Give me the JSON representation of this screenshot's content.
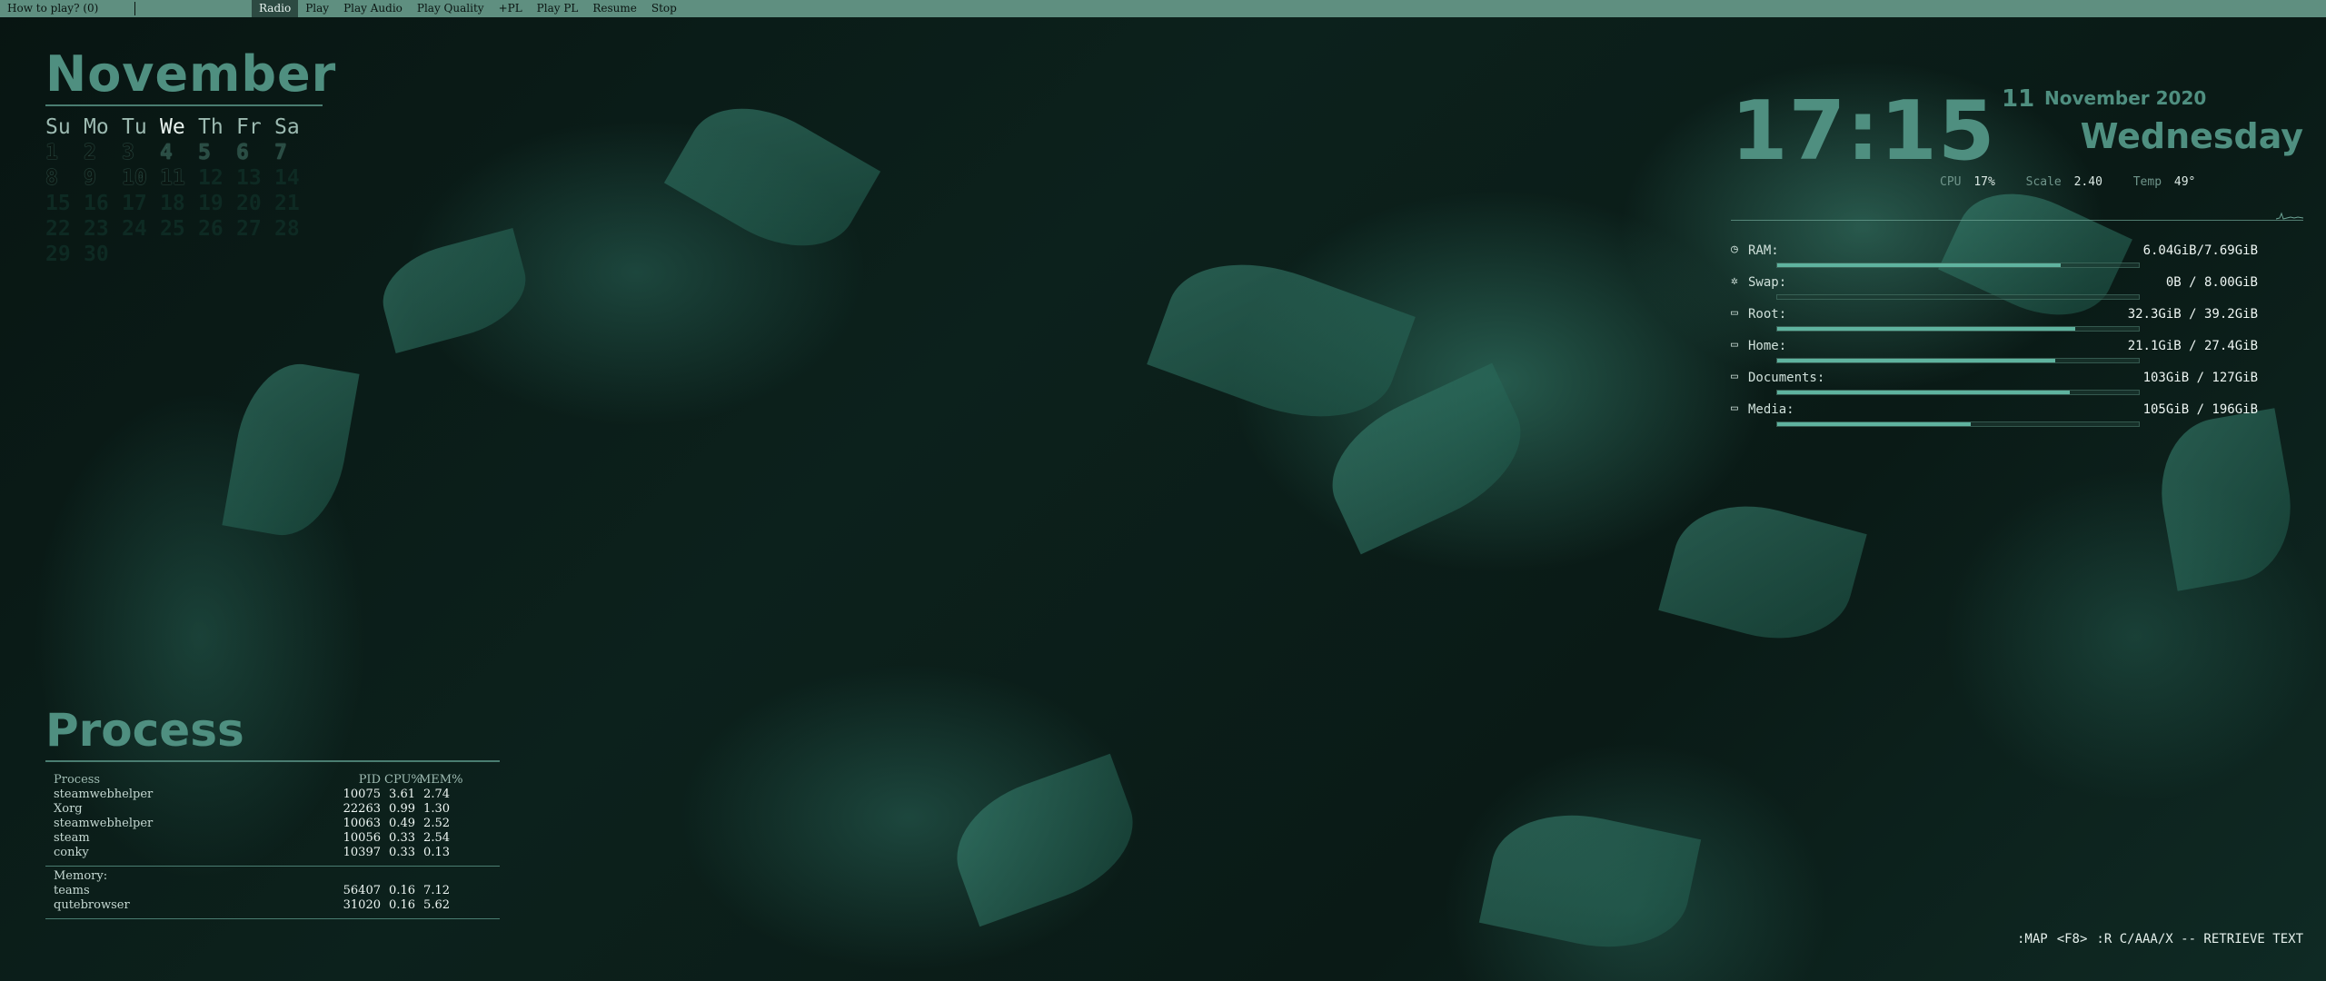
{
  "topbar": {
    "prompt": "How to play? (0)",
    "menu": [
      "Radio",
      "Play",
      "Play Audio",
      "Play Quality",
      "+PL",
      "Play PL",
      "Resume",
      "Stop"
    ],
    "active_item": "Radio"
  },
  "calendar": {
    "month": "November",
    "weekdays": [
      "Su",
      "Mo",
      "Tu",
      "We",
      "Th",
      "Fr",
      "Sa"
    ],
    "today_weekday": "We",
    "weeks": [
      [
        "1",
        "2",
        "3",
        "4",
        "5",
        "6",
        "7"
      ],
      [
        "8",
        "9",
        "10",
        "11",
        "12",
        "13",
        "14"
      ],
      [
        "15",
        "16",
        "17",
        "18",
        "19",
        "20",
        "21"
      ],
      [
        "22",
        "23",
        "24",
        "25",
        "26",
        "27",
        "28"
      ],
      [
        "29",
        "30",
        "",
        "",
        "",
        "",
        ""
      ]
    ],
    "today": "11"
  },
  "clock": {
    "time": "17:15",
    "day": "11",
    "month_year": "November 2020",
    "weekday": "Wednesday"
  },
  "sysline": {
    "cpu_label": "CPU",
    "cpu_value": "17%",
    "scale_label": "Scale",
    "scale_value": "2.40",
    "temp_label": "Temp",
    "temp_value": "49°"
  },
  "meters": [
    {
      "icon": "gauge-icon",
      "glyph": "◷",
      "label": "RAM:",
      "value": "6.04GiB/7.69GiB",
      "fraction": 0.785
    },
    {
      "icon": "swap-icon",
      "glyph": "✲",
      "label": "Swap:",
      "value": "0B / 8.00GiB",
      "fraction": 0.0
    },
    {
      "icon": "disk-icon",
      "glyph": "▭",
      "label": "Root:",
      "value": "32.3GiB / 39.2GiB",
      "fraction": 0.824
    },
    {
      "icon": "disk-icon",
      "glyph": "▭",
      "label": "Home:",
      "value": "21.1GiB / 27.4GiB",
      "fraction": 0.77
    },
    {
      "icon": "disk-icon",
      "glyph": "▭",
      "label": "Documents:",
      "value": "103GiB / 127GiB",
      "fraction": 0.81
    },
    {
      "icon": "disk-icon",
      "glyph": "▭",
      "label": "Media:",
      "value": "105GiB / 196GiB",
      "fraction": 0.536
    }
  ],
  "process": {
    "title": "Process",
    "header": {
      "name": "Process",
      "pid": "PID",
      "cpu": "CPU%",
      "mem": "MEM%"
    },
    "cpu_rows": [
      {
        "name": "steamwebhelper",
        "pid": "10075",
        "cpu": "3.61",
        "mem": "2.74"
      },
      {
        "name": "Xorg",
        "pid": "22263",
        "cpu": "0.99",
        "mem": "1.30"
      },
      {
        "name": "steamwebhelper",
        "pid": "10063",
        "cpu": "0.49",
        "mem": "2.52"
      },
      {
        "name": "steam",
        "pid": "10056",
        "cpu": "0.33",
        "mem": "2.54"
      },
      {
        "name": "conky",
        "pid": "10397",
        "cpu": "0.33",
        "mem": "0.13"
      }
    ],
    "memory_label": "Memory:",
    "mem_rows": [
      {
        "name": "teams",
        "pid": "56407",
        "cpu": "0.16",
        "mem": "7.12"
      },
      {
        "name": "qutebrowser",
        "pid": "31020",
        "cpu": "0.16",
        "mem": "5.62"
      }
    ]
  },
  "bottom_hint": [
    ":MAP",
    "<F8>",
    ":R C/AAA/X -- RETRIEVE TEXT"
  ]
}
